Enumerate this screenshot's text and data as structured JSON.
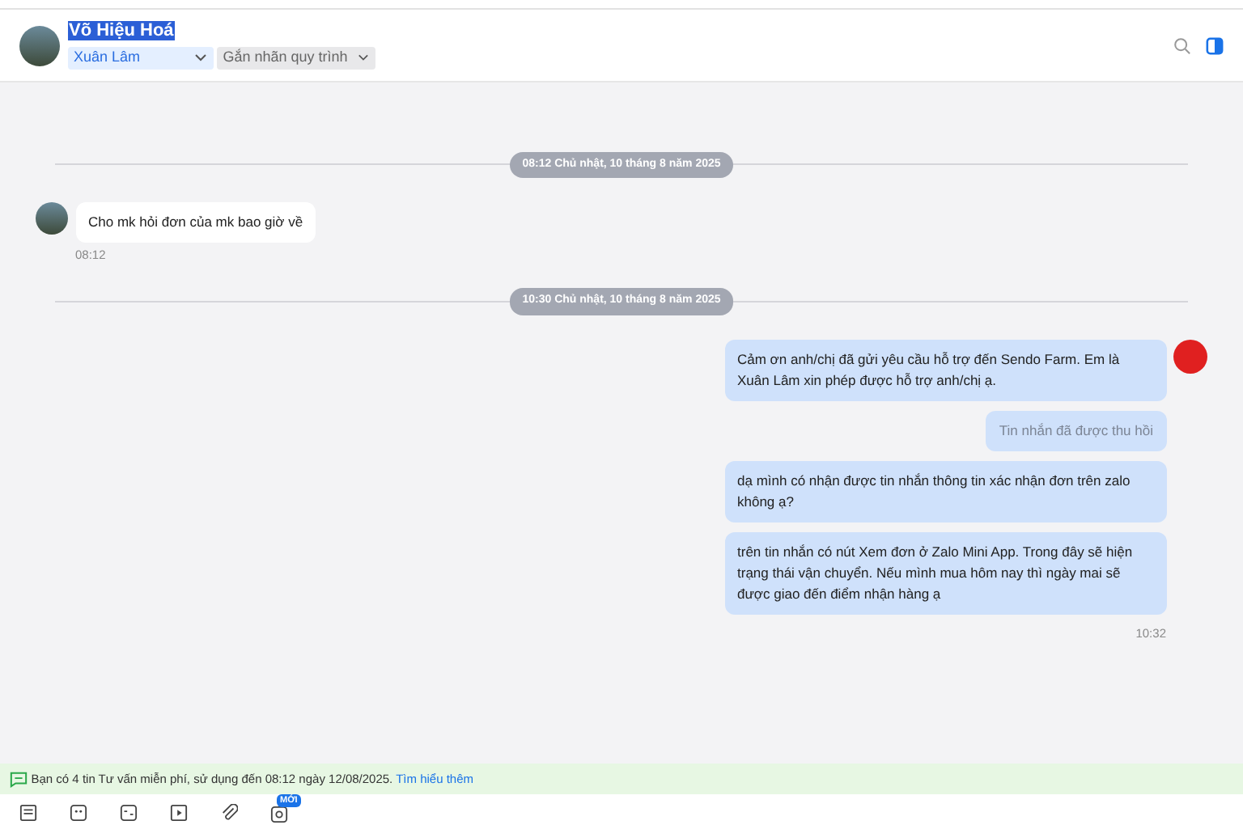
{
  "header": {
    "name": "Võ Hiệu Hoá",
    "name_selected": true,
    "assignee": "Xuân Lâm",
    "tag_placeholder": "Gắn nhãn quy trình"
  },
  "conversation": [
    {
      "kind": "divider",
      "text": "08:12 Chủ nhật, 10 tháng 8 năm 2025"
    },
    {
      "kind": "incoming",
      "messages": [
        {
          "text": "Cho mk hỏi đơn của mk bao giờ về",
          "recalled": false
        }
      ],
      "time": "08:12"
    },
    {
      "kind": "divider",
      "text": "10:30 Chủ nhật, 10 tháng 8 năm 2025"
    },
    {
      "kind": "outgoing",
      "messages": [
        {
          "text": "Cảm ơn anh/chị đã gửi yêu cầu hỗ trợ đến Sendo Farm. Em là Xuân Lâm xin phép được hỗ trợ anh/chị ạ.",
          "recalled": false
        },
        {
          "text": "Tin nhắn đã được thu hồi",
          "recalled": true
        },
        {
          "text": "dạ mình có nhận được tin nhắn thông tin xác nhận đơn trên zalo không ạ?",
          "recalled": false
        },
        {
          "text": "trên tin nhắn có nút Xem đơn ở Zalo Mini App. Trong đây sẽ hiện trạng thái vận chuyển. Nếu mình mua hôm nay thì ngày mai sẽ được giao đến điểm nhận hàng ạ",
          "recalled": false
        }
      ],
      "time": "10:32"
    }
  ],
  "notice": {
    "text": "Bạn có 4 tin Tư vấn miễn phí, sử dụng đến 08:12 ngày 12/08/2025.",
    "link": "Tìm hiểu thêm"
  },
  "toolbar": {
    "badge": "MỚI"
  }
}
